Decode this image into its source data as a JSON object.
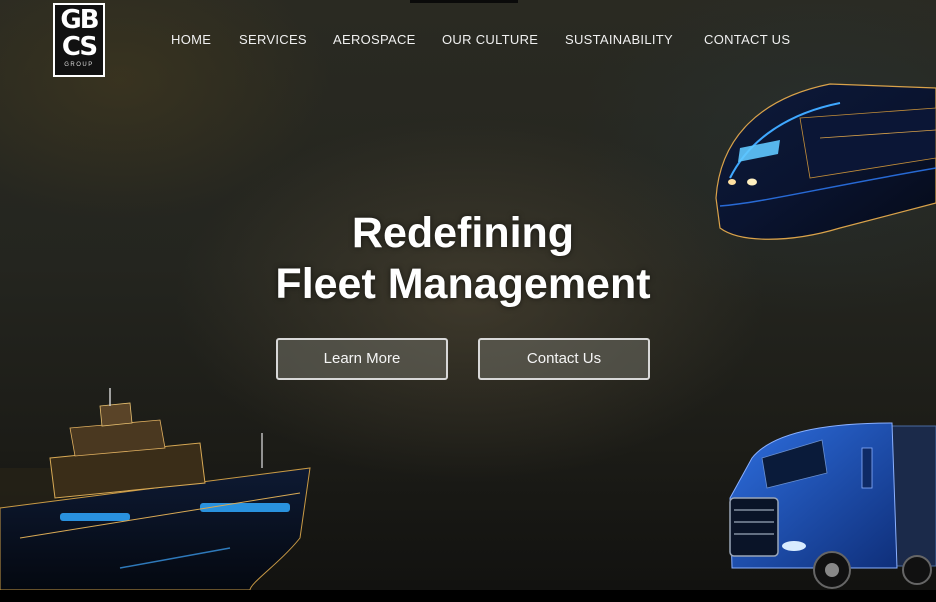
{
  "logo": {
    "line1": "GB",
    "line2": "CS",
    "line3": "GROUP"
  },
  "nav": {
    "items": [
      {
        "label": "HOME"
      },
      {
        "label": "SERVICES"
      },
      {
        "label": "AEROSPACE"
      },
      {
        "label": "OUR CULTURE"
      },
      {
        "label": "SUSTAINABILITY"
      },
      {
        "label": "CONTACT US"
      }
    ]
  },
  "hero": {
    "title_line1": "Redefining",
    "title_line2": "Fleet Management",
    "primary_button": "Learn More",
    "secondary_button": "Contact Us"
  },
  "images": {
    "train": "futuristic-train-image",
    "ship": "cruise-ship-image",
    "truck": "semi-truck-image"
  },
  "colors": {
    "accent_blue": "#2f7fff",
    "glow_blue": "#38b8ff",
    "text": "#ffffff"
  }
}
